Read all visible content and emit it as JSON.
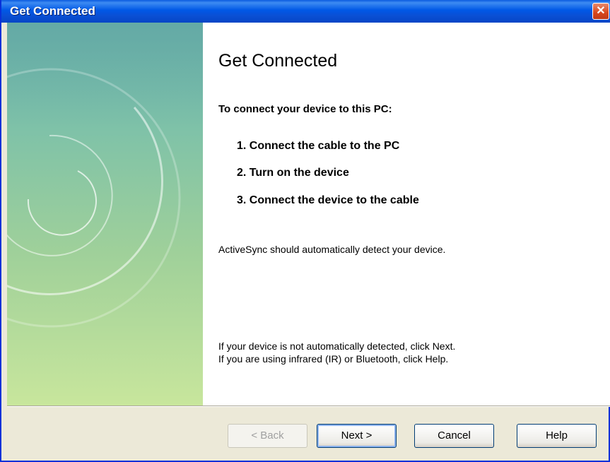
{
  "window": {
    "title": "Get Connected",
    "close_icon": "close-icon",
    "close_glyph": "✕"
  },
  "content": {
    "heading": "Get Connected",
    "intro": "To connect your device to this PC:",
    "steps": [
      "1. Connect the cable to the PC",
      "2. Turn on the device",
      "3. Connect the device to the cable"
    ],
    "autodetect": "ActiveSync should automatically detect your device.",
    "note_line1": "If your device is not automatically detected, click Next.",
    "note_line2": "If you are using infrared (IR) or Bluetooth, click Help."
  },
  "buttons": {
    "back": "< Back",
    "next": "Next >",
    "cancel": "Cancel",
    "help": "Help"
  },
  "colors": {
    "titlebar": "#0058e6",
    "panel_top": "#6fb5ac",
    "panel_bottom": "#c8e69c",
    "dialog_bg": "#ece9d8"
  }
}
